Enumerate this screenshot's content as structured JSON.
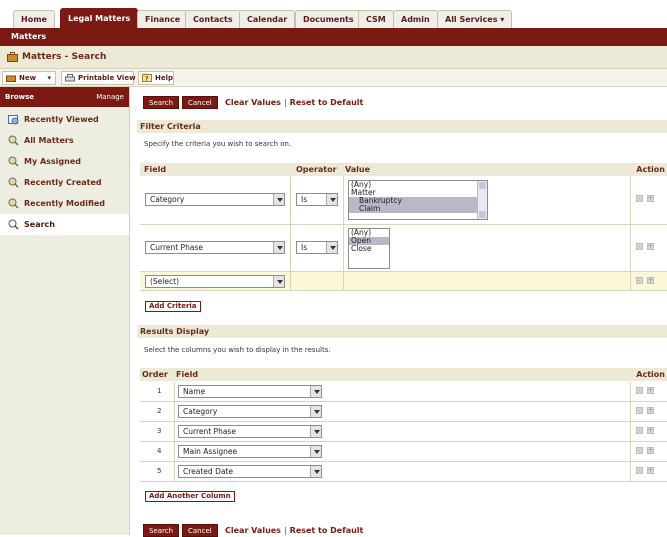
{
  "tabs": [
    "Home",
    "Legal Matters",
    "Finance",
    "Contacts",
    "Calendar",
    "Documents",
    "CSM",
    "Admin",
    "All Services ▾"
  ],
  "active_tab": 1,
  "subnav": {
    "label": "Matters"
  },
  "page": {
    "title": "Matters - Search"
  },
  "toolbar": {
    "new_label": "New",
    "printable_label": "Printable View",
    "help_label": "Help"
  },
  "sidebar": {
    "browse_label": "Browse",
    "manage_label": "Manage",
    "items": [
      "Recently Viewed",
      "All Matters",
      "My Assigned",
      "Recently Created",
      "Recently Modified",
      "Search"
    ]
  },
  "actions": {
    "search_label": "Search",
    "cancel_label": "Cancel",
    "clear_label": "Clear Values",
    "sep": "|",
    "reset_label": "Reset to Default"
  },
  "filter": {
    "title": "Filter Criteria",
    "description": "Specify the criteria you wish to search on.",
    "headers": {
      "field": "Field",
      "operator": "Operator",
      "value": "Value",
      "action": "Action"
    },
    "rows": [
      {
        "field": "Category",
        "operator": "Is",
        "options": [
          "(Any)",
          "Matter",
          "Bankruptcy",
          "Claim"
        ]
      },
      {
        "field": "Current Phase",
        "operator": "Is",
        "options": [
          "(Any)",
          "Open",
          "Close"
        ]
      },
      {
        "field": "(Select)"
      }
    ],
    "add_label": "Add Criteria"
  },
  "results": {
    "title": "Results Display",
    "description": "Select the columns you wish to display in the results.",
    "headers": {
      "order": "Order",
      "field": "Field",
      "action": "Action"
    },
    "rows": [
      {
        "order": "1",
        "field": "Name"
      },
      {
        "order": "2",
        "field": "Category"
      },
      {
        "order": "3",
        "field": "Current Phase"
      },
      {
        "order": "4",
        "field": "Main Assignee"
      },
      {
        "order": "5",
        "field": "Created Date"
      }
    ],
    "add_label": "Add Another Column"
  },
  "icons": {
    "minus": "-",
    "plus": "+"
  },
  "colors": {
    "accent": "#7a1a12",
    "header_bg": "#ecead7",
    "sidebar_bg": "#eeede2"
  }
}
